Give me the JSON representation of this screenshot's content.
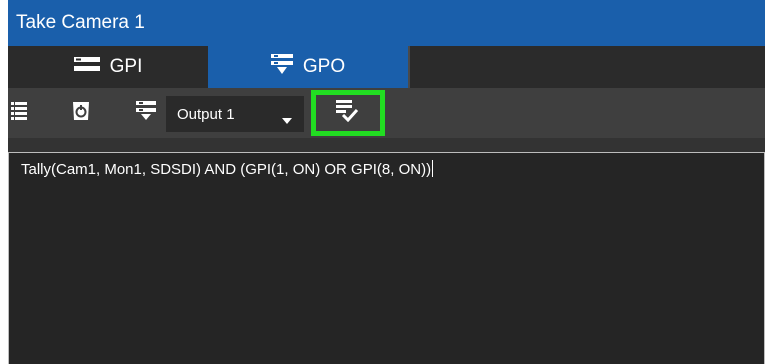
{
  "window": {
    "title": "Take Camera 1"
  },
  "tabs": [
    {
      "label": "GPI",
      "icon": "gpi-icon",
      "active": false
    },
    {
      "label": "GPO",
      "icon": "gpo-icon",
      "active": true
    }
  ],
  "toolbar": {
    "list_icon": "list-icon",
    "trigger_icon": "trigger-icon",
    "output_icon": "gpo-output-icon",
    "output_select": {
      "value": "Output 1"
    },
    "apply_icon": "apply-check-icon"
  },
  "editor": {
    "expression": "Tally(Cam1, Mon1, SDSDI) AND (GPI(1, ON) OR GPI(8, ON))"
  },
  "colors": {
    "accent": "#1a5fab",
    "panel": "#333333",
    "toolbar": "#3f3f3f",
    "editor_bg": "#252525",
    "highlight": "#22dd22"
  }
}
